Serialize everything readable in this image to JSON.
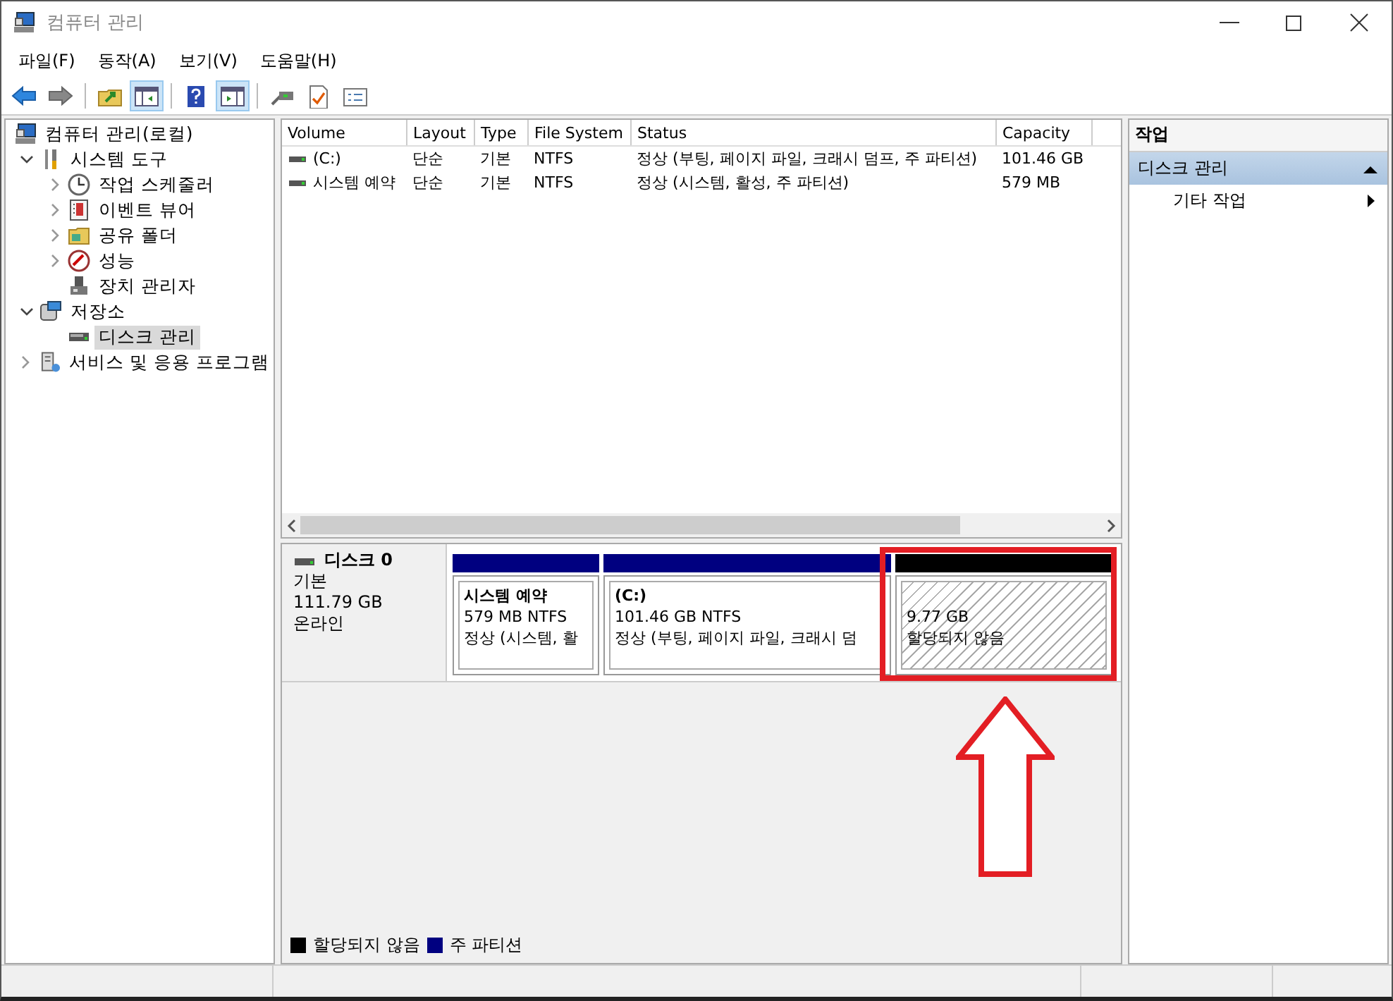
{
  "window": {
    "title": "컴퓨터 관리"
  },
  "menu": [
    "파일(F)",
    "동작(A)",
    "보기(V)",
    "도움말(H)"
  ],
  "toolbar": [
    {
      "pressed": false
    },
    {
      "pressed": false
    },
    {
      "pressed": false
    },
    {
      "pressed": true
    },
    {
      "pressed": false
    },
    {
      "pressed": true
    },
    {
      "pressed": false
    },
    {
      "pressed": false
    },
    {
      "pressed": false
    }
  ],
  "tree": [
    {
      "label": "컴퓨터 관리(로컬)",
      "selected": false,
      "children": [
        {
          "label": "시스템 도구",
          "selected": false,
          "expanded": true,
          "children": [
            {
              "label": "작업 스케줄러",
              "selected": false,
              "expanded": false
            },
            {
              "label": "이벤트 뷰어",
              "selected": false,
              "expanded": false
            },
            {
              "label": "공유 폴더",
              "selected": false,
              "expanded": false
            },
            {
              "label": "성능",
              "selected": false,
              "expanded": false
            },
            {
              "label": "장치 관리자",
              "selected": false
            }
          ]
        },
        {
          "label": "저장소",
          "selected": false,
          "expanded": true,
          "children": [
            {
              "label": "디스크 관리",
              "selected": true
            }
          ]
        },
        {
          "label": "서비스 및 응용 프로그램",
          "selected": false,
          "expanded": false
        }
      ]
    }
  ],
  "table": {
    "columns": [
      "Volume",
      "Layout",
      "Type",
      "File System",
      "Status",
      "Capacity"
    ],
    "rows": [
      [
        "(C:)",
        "단순",
        "기본",
        "NTFS",
        "정상 (부팅, 페이지 파일, 크래시 덤프, 주 파티션)",
        "101.46 GB"
      ],
      [
        "시스템 예약",
        "단순",
        "기본",
        "NTFS",
        "정상 (시스템, 활성, 주 파티션)",
        "579 MB"
      ]
    ]
  },
  "disk": {
    "name": "디스크 0",
    "type": "기본",
    "size": "111.79 GB",
    "status": "온라인",
    "partitions": [
      {
        "kind": "primary",
        "color": "#000080",
        "name": "시스템 예약",
        "size": "579 MB NTFS",
        "status": "정상 (시스템, 활"
      },
      {
        "kind": "primary",
        "color": "#000080",
        "name": "(C:)",
        "size": "101.46 GB NTFS",
        "status": "정상 (부팅, 페이지 파일, 크래시 덤"
      },
      {
        "kind": "unallocated",
        "color": "#000000",
        "size": "9.77 GB",
        "status": "할당되지 않음"
      }
    ]
  },
  "legend": [
    {
      "label": "할당되지 않음",
      "color": "#000000"
    },
    {
      "label": "주 파티션",
      "color": "#000080"
    }
  ],
  "actions": {
    "header": "작업",
    "section": {
      "label": "디스크 관리",
      "expanded": true
    },
    "items": [
      "기타 작업"
    ]
  }
}
